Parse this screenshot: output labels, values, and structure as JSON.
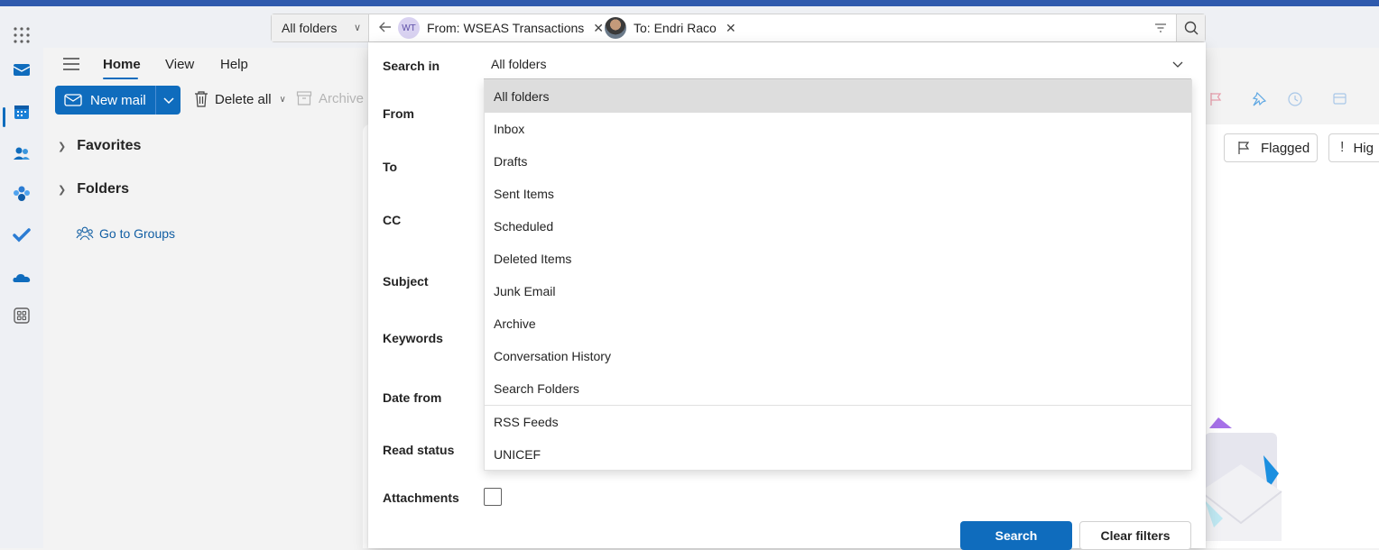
{
  "header": {
    "scope": "All folders",
    "chips": [
      {
        "avatar_text": "WT",
        "label": "From: WSEAS Transactions"
      },
      {
        "label": "To: Endri Raco"
      }
    ]
  },
  "ribbon_tabs": [
    "Home",
    "View",
    "Help"
  ],
  "ribbon": {
    "new_mail": "New mail",
    "delete_all": "Delete all",
    "archive": "Archive"
  },
  "nav": {
    "favorites": "Favorites",
    "folders": "Folders",
    "go_to_groups": "Go to Groups"
  },
  "pills": {
    "flagged": "Flagged",
    "high": "Hig"
  },
  "panel": {
    "labels": {
      "search_in": "Search in",
      "from": "From",
      "to": "To",
      "cc": "CC",
      "subject": "Subject",
      "keywords": "Keywords",
      "date_from": "Date from",
      "read_status": "Read status",
      "attachments": "Attachments"
    },
    "search_in_value": "All folders",
    "search_button": "Search",
    "clear_button": "Clear filters"
  },
  "dropdown": {
    "selected": "All folders",
    "options": [
      "All folders",
      "Inbox",
      "Drafts",
      "Sent Items",
      "Scheduled",
      "Deleted Items",
      "Junk Email",
      "Archive",
      "Conversation History",
      "Search Folders",
      "RSS Feeds",
      "UNICEF"
    ]
  },
  "colors": {
    "accent": "#0f6cbd",
    "topbar": "#2f5aad",
    "selected_option": "#dddddd"
  },
  "icons": [
    "app-launcher-icon",
    "back-arrow-icon",
    "filter-icon",
    "search-icon",
    "mail-icon",
    "calendar-icon",
    "people-icon",
    "teams-icon",
    "todo-icon",
    "onedrive-icon",
    "apps-icon",
    "hamburger-icon",
    "trash-icon",
    "archive-icon",
    "flag-icon",
    "pin-icon",
    "clock-icon",
    "chevron-down-icon",
    "groups-icon"
  ]
}
